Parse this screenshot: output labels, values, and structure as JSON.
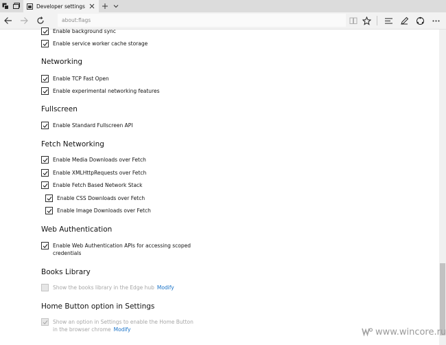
{
  "window": {
    "tab_title": "Developer settings",
    "address": "about:flags"
  },
  "sections": [
    {
      "heading": null,
      "options": [
        {
          "label": "Enable background sync",
          "checked": true
        },
        {
          "label": "Enable service worker cache storage",
          "checked": true
        }
      ]
    },
    {
      "heading": "Networking",
      "options": [
        {
          "label": "Enable TCP Fast Open",
          "checked": true
        },
        {
          "label": "Enable experimental networking features",
          "checked": true
        }
      ]
    },
    {
      "heading": "Fullscreen",
      "options": [
        {
          "label": "Enable Standard Fullscreen API",
          "checked": true
        }
      ]
    },
    {
      "heading": "Fetch Networking",
      "options": [
        {
          "label": "Enable Media Downloads over Fetch",
          "checked": true
        },
        {
          "label": "Enable XMLHttpRequests over Fetch",
          "checked": true
        },
        {
          "label": "Enable Fetch Based Network Stack",
          "checked": true
        },
        {
          "label": "Enable CSS Downloads over Fetch",
          "checked": true
        },
        {
          "label": "Enable Image Downloads over Fetch",
          "checked": true
        }
      ]
    },
    {
      "heading": "Web Authentication",
      "options": [
        {
          "label_line1": "Enable Web Authentication APIs for accessing scoped",
          "label_line2": "credentials",
          "checked": true
        }
      ]
    },
    {
      "heading": "Books Library",
      "options": [
        {
          "label": "Show the books library in the Edge hub",
          "link": "Modify",
          "checked": false,
          "disabled": true
        }
      ]
    },
    {
      "heading": "Home Button option in Settings",
      "options": [
        {
          "label_line1": "Show an option in Settings to enable the Home Button",
          "label_line2": "in the browser chrome",
          "link": "Modify",
          "checked": true,
          "disabled": true
        }
      ]
    }
  ],
  "watermark": "www.wincore.ru",
  "colors": {
    "link": "#1a73c8",
    "titlebar": "#dcdcdc",
    "toolbar": "#f2f2f2",
    "disabled_text": "#a6a6a6"
  }
}
